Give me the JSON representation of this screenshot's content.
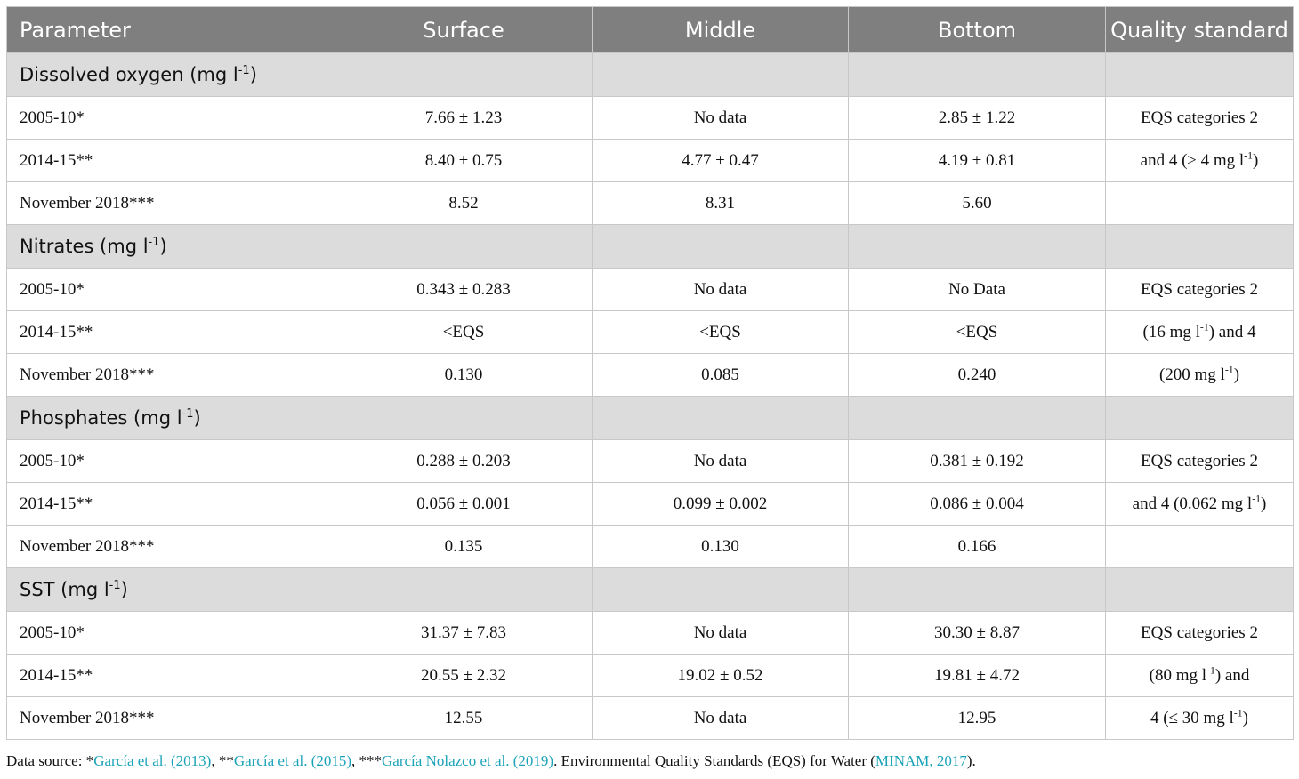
{
  "header": {
    "parameter": "Parameter",
    "surface": "Surface",
    "middle": "Middle",
    "bottom": "Bottom",
    "standard": "Quality standard"
  },
  "sections": [
    {
      "label": "Dissolved oxygen (mg l",
      "label_sup": "-1",
      "label_end": ")",
      "rows": [
        {
          "period": "2005-10*",
          "surface": "7.66 ± 1.23",
          "middle": "No data",
          "bottom": "2.85 ± 1.22",
          "std_pre": "EQS categories 2",
          "std_sup": "",
          "std_post": ""
        },
        {
          "period": "2014-15**",
          "surface": "8.40 ± 0.75",
          "middle": "4.77 ± 0.47",
          "bottom": "4.19 ± 0.81",
          "std_pre": "and 4 (≥ 4 mg l",
          "std_sup": "-1",
          "std_post": ")"
        },
        {
          "period": "November 2018***",
          "surface": "8.52",
          "middle": "8.31",
          "bottom": "5.60",
          "std_pre": "",
          "std_sup": "",
          "std_post": ""
        }
      ]
    },
    {
      "label": "Nitrates (mg l",
      "label_sup": "-1",
      "label_end": ")",
      "rows": [
        {
          "period": "2005-10*",
          "surface": "0.343 ± 0.283",
          "middle": "No data",
          "bottom": "No Data",
          "std_pre": "EQS categories 2",
          "std_sup": "",
          "std_post": ""
        },
        {
          "period": "2014-15**",
          "surface": "<EQS",
          "middle": "<EQS",
          "bottom": "<EQS",
          "std_pre": "(16 mg l",
          "std_sup": "-1",
          "std_post": ") and 4"
        },
        {
          "period": "November 2018***",
          "surface": "0.130",
          "middle": "0.085",
          "bottom": "0.240",
          "std_pre": "(200 mg l",
          "std_sup": "-1",
          "std_post": ")"
        }
      ]
    },
    {
      "label": "Phosphates (mg l",
      "label_sup": "-1",
      "label_end": ")",
      "rows": [
        {
          "period": "2005-10*",
          "surface": "0.288 ± 0.203",
          "middle": "No data",
          "bottom": "0.381 ± 0.192",
          "std_pre": "EQS categories 2",
          "std_sup": "",
          "std_post": ""
        },
        {
          "period": "2014-15**",
          "surface": "0.056 ± 0.001",
          "middle": "0.099 ± 0.002",
          "bottom": "0.086 ± 0.004",
          "std_pre": "and 4 (0.062 mg l",
          "std_sup": "-1",
          "std_post": ")"
        },
        {
          "period": "November 2018***",
          "surface": "0.135",
          "middle": "0.130",
          "bottom": "0.166",
          "std_pre": "",
          "std_sup": "",
          "std_post": ""
        }
      ]
    },
    {
      "label": "SST (mg l",
      "label_sup": "-1",
      "label_end": ")",
      "rows": [
        {
          "period": "2005-10*",
          "surface": "31.37 ± 7.83",
          "middle": "No data",
          "bottom": "30.30 ± 8.87",
          "std_pre": "EQS categories 2",
          "std_sup": "",
          "std_post": ""
        },
        {
          "period": "2014-15**",
          "surface": "20.55 ± 2.32",
          "middle": "19.02 ± 0.52",
          "bottom": "19.81 ± 4.72",
          "std_pre": "(80 mg l",
          "std_sup": "-1",
          "std_post": ") and"
        },
        {
          "period": "November 2018***",
          "surface": "12.55",
          "middle": "No data",
          "bottom": "12.95",
          "std_pre": "4 (≤ 30 mg l",
          "std_sup": "-1",
          "std_post": ")"
        }
      ]
    }
  ],
  "footnote": {
    "prefix": "Data source: *",
    "cite1": "García et al. (2013)",
    "sep1": ", **",
    "cite2": "García et al. (2015)",
    "sep2": ", ***",
    "cite3": "García Nolazco et al. (2019)",
    "middle": ". Environmental Quality Standards (EQS) for Water (",
    "cite4": "MINAM, 2017",
    "suffix": ")."
  },
  "colors": {
    "header_bg": "#7f7f7f",
    "section_bg": "#dcdcdc",
    "link": "#1aa3b8"
  }
}
